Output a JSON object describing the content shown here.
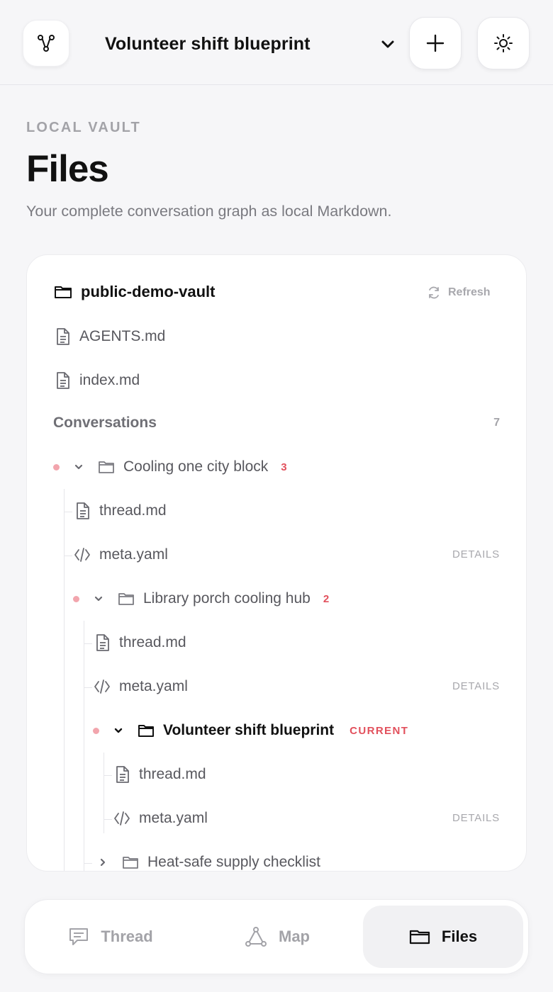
{
  "header": {
    "document_title": "Volunteer shift blueprint",
    "icons": {
      "logo": "graph-nodes-icon",
      "switcher": "chevron-down-icon",
      "add": "plus-icon",
      "theme": "sun-icon"
    }
  },
  "page": {
    "eyebrow": "LOCAL VAULT",
    "title": "Files",
    "subtitle": "Your complete conversation graph as local Markdown."
  },
  "vault": {
    "name": "public-demo-vault",
    "refresh_label": "Refresh",
    "root_files": [
      "AGENTS.md",
      "index.md"
    ],
    "section_label": "Conversations",
    "section_count": "7"
  },
  "tree": {
    "cooling": {
      "title": "Cooling one city block",
      "count": "3",
      "thread": "thread.md",
      "meta": "meta.yaml",
      "details": "DETAILS"
    },
    "porch": {
      "title": "Library porch cooling hub",
      "count": "2",
      "thread": "thread.md",
      "meta": "meta.yaml",
      "details": "DETAILS"
    },
    "shift": {
      "title": "Volunteer shift blueprint",
      "current": "CURRENT",
      "thread": "thread.md",
      "meta": "meta.yaml",
      "details": "DETAILS"
    },
    "supply": {
      "title": "Heat-safe supply checklist"
    }
  },
  "nav": {
    "items": [
      {
        "label": "Thread",
        "icon": "chat-bubble-icon"
      },
      {
        "label": "Map",
        "icon": "triangle-graph-icon"
      },
      {
        "label": "Files",
        "icon": "folder-icon"
      }
    ],
    "active": "Files"
  },
  "colors": {
    "accent": "#e2505c",
    "dot": "#f2a5ad",
    "muted": "#a3a3a8",
    "background": "#f6f6f8"
  }
}
